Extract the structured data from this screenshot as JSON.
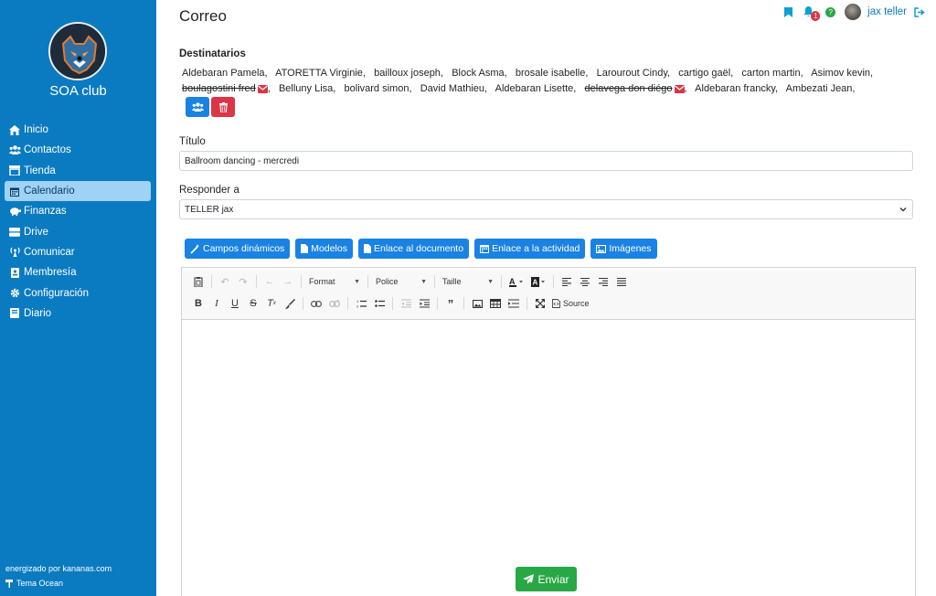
{
  "sidebar": {
    "club_name": "SOA club",
    "items": [
      {
        "label": "Inicio",
        "icon": "home-icon"
      },
      {
        "label": "Contactos",
        "icon": "users-icon"
      },
      {
        "label": "Tienda",
        "icon": "store-icon"
      },
      {
        "label": "Calendario",
        "icon": "calendar-icon",
        "active": true
      },
      {
        "label": "Finanzas",
        "icon": "piggy-bank-icon"
      },
      {
        "label": "Drive",
        "icon": "hdd-icon"
      },
      {
        "label": "Comunicar",
        "icon": "broadcast-icon"
      },
      {
        "label": "Membresía",
        "icon": "id-card-icon"
      },
      {
        "label": "Configuración",
        "icon": "gear-icon"
      },
      {
        "label": "Diario",
        "icon": "book-icon"
      }
    ],
    "powered_by": "energizado por kananas.com",
    "theme": "Tema Ocean"
  },
  "header": {
    "title": "Correo",
    "notifications_count": "1",
    "help_badge": "?",
    "user_name": "jax teller"
  },
  "recipients": {
    "label": "Destinatarios",
    "list": [
      {
        "name": "Aldebaran Pamela,",
        "struck": false
      },
      {
        "name": "ATORETTA Virginie,",
        "struck": false
      },
      {
        "name": "bailloux joseph,",
        "struck": false
      },
      {
        "name": "Block Asma,",
        "struck": false
      },
      {
        "name": "brosale isabelle,",
        "struck": false
      },
      {
        "name": "Larourout Cindy,",
        "struck": false
      },
      {
        "name": "cartigo gaël,",
        "struck": false
      },
      {
        "name": "carton martin,",
        "struck": false
      },
      {
        "name": "Asimov kevin,",
        "struck": false
      },
      {
        "name": "boulagostini fred",
        "struck": true
      },
      {
        "name": "Belluny Lisa,",
        "struck": false
      },
      {
        "name": "bolivard simon,",
        "struck": false
      },
      {
        "name": "David Mathieu,",
        "struck": false
      },
      {
        "name": "Aldebaran Lisette,",
        "struck": false
      },
      {
        "name": "delavega don diégo",
        "struck": true
      },
      {
        "name": "Aldebaran francky,",
        "struck": false
      },
      {
        "name": "Ambezati Jean,",
        "struck": false
      }
    ]
  },
  "form": {
    "title_label": "Título",
    "title_value": "Ballroom dancing - mercredi",
    "reply_label": "Responder a",
    "reply_value": "TELLER jax"
  },
  "actions": {
    "dynamic_fields": "Campos dinámicos",
    "templates": "Modelos",
    "document_link": "Enlace al documento",
    "activity_link": "Enlace a la actividad",
    "images": "Imágenes"
  },
  "editor": {
    "format_label": "Format",
    "font_label": "Police",
    "size_label": "Taille",
    "source_label": "Source"
  },
  "send_label": "Enviar",
  "colors": {
    "sidebar": "#0b7bc1",
    "primary": "#1a82e2",
    "danger": "#dc3545",
    "success": "#28a745"
  }
}
